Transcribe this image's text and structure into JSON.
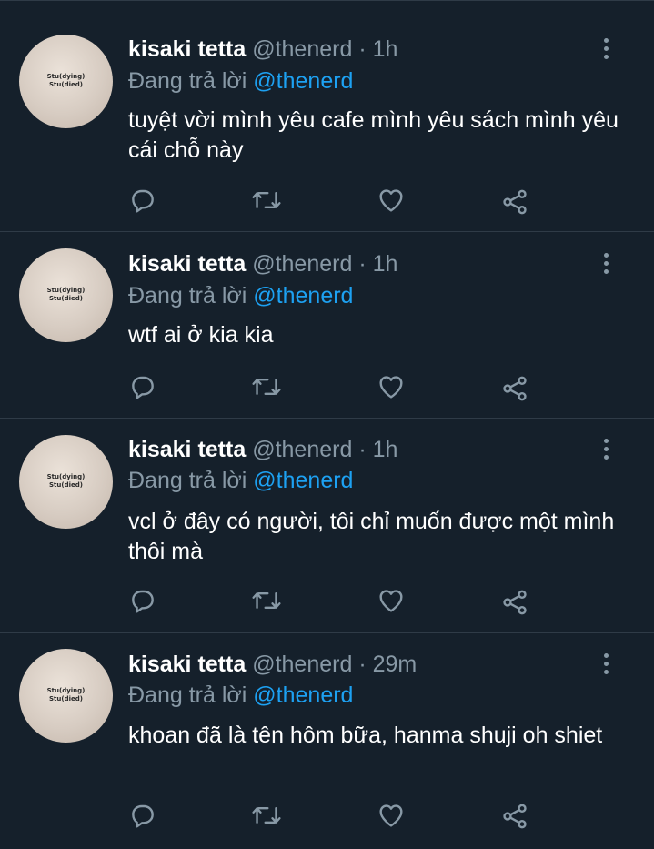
{
  "tweets": [
    {
      "name": "kisaki tetta",
      "handle": "@thenerd",
      "dot": "·",
      "time": "1h",
      "reply_prefix": "Đang trả lời",
      "reply_to": "@thenerd",
      "text": "tuyệt vời mình yêu cafe mình yêu sách mình yêu cái chỗ này",
      "avatar_text": [
        "Stu(dying)",
        "Stu(died)"
      ]
    },
    {
      "name": "kisaki tetta",
      "handle": "@thenerd",
      "dot": "·",
      "time": "1h",
      "reply_prefix": "Đang trả lời",
      "reply_to": "@thenerd",
      "text": "wtf ai ở kia kia",
      "avatar_text": [
        "Stu(dying)",
        "Stu(died)"
      ]
    },
    {
      "name": "kisaki tetta",
      "handle": "@thenerd",
      "dot": "·",
      "time": "1h",
      "reply_prefix": "Đang trả lời",
      "reply_to": "@thenerd",
      "text": "vcl ở đây có người, tôi chỉ muốn được một mình thôi mà",
      "avatar_text": [
        "Stu(dying)",
        "Stu(died)"
      ]
    },
    {
      "name": "kisaki tetta",
      "handle": "@thenerd",
      "dot": "·",
      "time": "29m",
      "reply_prefix": "Đang trả lời",
      "reply_to": "@thenerd",
      "text": "khoan đã là tên hôm bữa, hanma shuji oh shiet",
      "avatar_text": [
        "Stu(dying)",
        "Stu(died)"
      ]
    }
  ],
  "icons": {
    "reply": "reply-icon",
    "retweet": "retweet-icon",
    "like": "heart-icon",
    "share": "share-icon",
    "more": "more-vertical-icon"
  },
  "colors": {
    "background": "#15202b",
    "divider": "#2f3b47",
    "secondary_text": "#8899a6",
    "mention": "#1da1f2"
  }
}
